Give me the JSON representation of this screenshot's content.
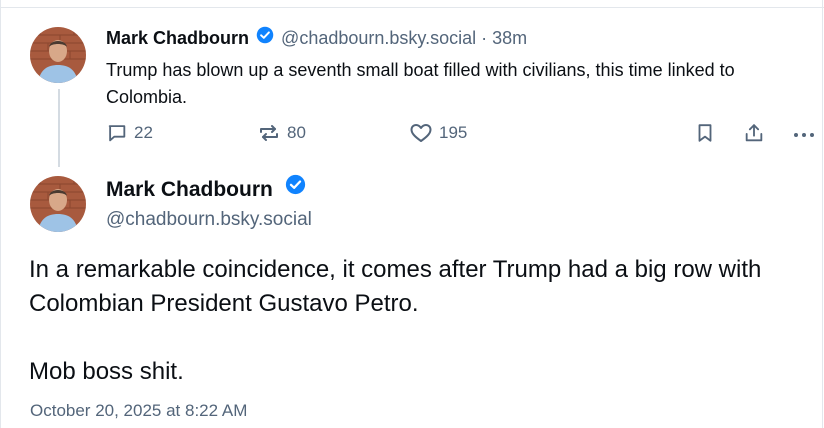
{
  "parent_post": {
    "author_name": "Mark Chadbourn",
    "author_handle": "@chadbourn.bsky.social",
    "separator": "·",
    "time_ago": "38m",
    "text": "Trump has blown up a seventh small boat filled with civilians, this time linked to Colombia.",
    "actions": {
      "reply_count": "22",
      "repost_count": "80",
      "like_count": "195"
    }
  },
  "main_post": {
    "author_name": "Mark Chadbourn",
    "author_handle": "@chadbourn.bsky.social",
    "paragraphs": [
      "In a remarkable coincidence, it comes after Trump had a big row with Colombian President Gustavo Petro.",
      "Mob boss shit."
    ],
    "timestamp": "October 20, 2025 at 8:22 AM"
  },
  "icons": {
    "verified": "verified-check-icon",
    "reply": "speech-bubble-icon",
    "repost": "repost-arrows-icon",
    "like": "heart-icon",
    "bookmark": "bookmark-icon",
    "share": "share-icon",
    "more": "ellipsis-icon"
  },
  "colors": {
    "verified_blue": "#1083fe",
    "muted_text": "#53657a",
    "primary_text": "#0b0f14",
    "divider": "#e3e7ec"
  }
}
